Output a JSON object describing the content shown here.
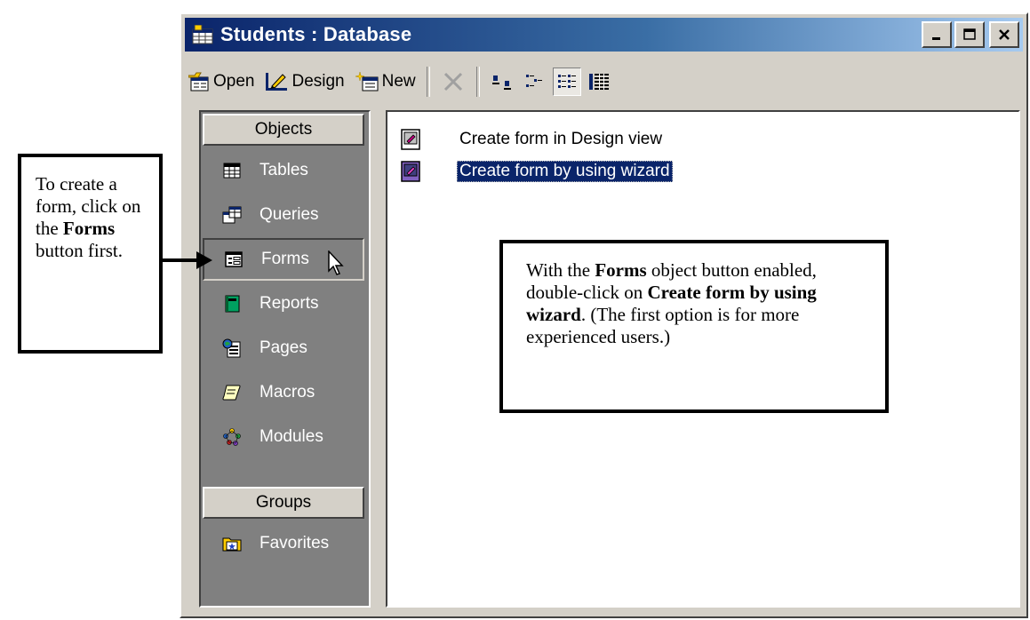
{
  "window": {
    "title": "Students : Database",
    "controls": [
      "minimize",
      "maximize",
      "close"
    ]
  },
  "toolbar": {
    "open_label": "Open",
    "design_label": "Design",
    "new_label": "New"
  },
  "objects_bar": {
    "objects_header": "Objects",
    "items": [
      {
        "label": "Tables",
        "icon": "table-icon"
      },
      {
        "label": "Queries",
        "icon": "query-icon"
      },
      {
        "label": "Forms",
        "icon": "form-icon",
        "selected": true
      },
      {
        "label": "Reports",
        "icon": "report-icon"
      },
      {
        "label": "Pages",
        "icon": "page-icon"
      },
      {
        "label": "Macros",
        "icon": "macro-icon"
      },
      {
        "label": "Modules",
        "icon": "module-icon"
      }
    ],
    "groups_header": "Groups",
    "groups": [
      {
        "label": "Favorites",
        "icon": "favorites-folder-icon"
      }
    ]
  },
  "list": {
    "items": [
      {
        "label": "Create form in Design view",
        "selected": false
      },
      {
        "label": "Create form by using wizard",
        "selected": true
      }
    ]
  },
  "callouts": {
    "left": {
      "line1": "To create a form, click on the ",
      "bold": "Forms",
      "line2": " button first."
    },
    "right": {
      "p1": "With the ",
      "b1": "Forms",
      "p2": " object button enabled, double-click on ",
      "b2": "Create form by using wizard",
      "p3": ".  (The first option is for more experienced users.)"
    }
  },
  "colors": {
    "title_bar_start": "#0a246a",
    "title_bar_end": "#a6caf0",
    "objects_bar_bg": "#808080",
    "selection": "#0a246a",
    "window_face": "#d4d0c8"
  }
}
